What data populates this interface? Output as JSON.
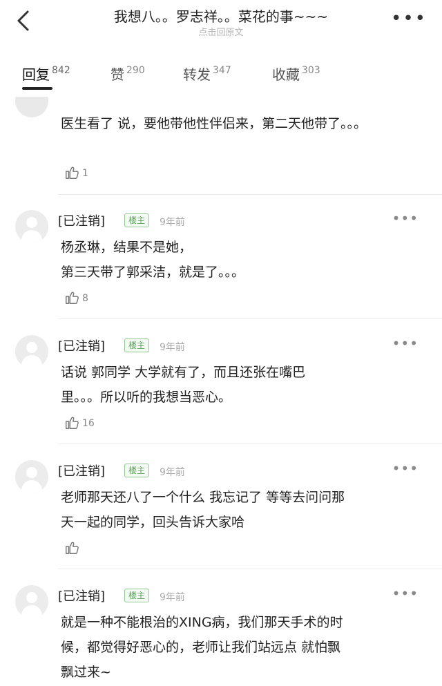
{
  "header": {
    "title": "我想八。。罗志祥。。菜花的事~~~",
    "subtitle": "点击回原文",
    "more_glyph": "•••"
  },
  "tabs": [
    {
      "label": "回复",
      "count": "842",
      "active": true
    },
    {
      "label": "赞",
      "count": "290",
      "active": false
    },
    {
      "label": "转发",
      "count": "347",
      "active": false
    },
    {
      "label": "收藏",
      "count": "303",
      "active": false
    }
  ],
  "top_comment": {
    "text": "医生看了 说，要他带他性伴侣来，第二天他带了。。。",
    "likes": "1"
  },
  "comments": [
    {
      "name": "[已注销]",
      "badge": "楼主",
      "time": "9年前",
      "text_lines": [
        "杨丞琳，结果不是她，",
        "第三天带了郭采洁，就是了。。。"
      ],
      "likes": "8"
    },
    {
      "name": "[已注销]",
      "badge": "楼主",
      "time": "9年前",
      "text_lines": [
        "话说 郭同学 大学就有了，而且还张在嘴巴",
        "里。。。所以听的我想当恶心。"
      ],
      "likes": "16"
    },
    {
      "name": "[已注销]",
      "badge": "楼主",
      "time": "9年前",
      "text_lines": [
        "老师那天还八了一个什么 我忘记了 等等去问问那",
        "天一起的同学，回头告诉大家哈"
      ],
      "likes": ""
    },
    {
      "name": "[已注销]",
      "badge": "楼主",
      "time": "9年前",
      "text_lines": [
        "就是一种不能根治的XING病，我们那天手术的时",
        "候，都觉得好恶心的，老师让我们站远点 就怕飘",
        "飘过来~"
      ],
      "likes": ""
    }
  ],
  "icons": {
    "back": "chevron-left-icon",
    "more": "more-dots-icon",
    "like": "thumbs-up-icon",
    "avatar": "default-avatar-icon"
  },
  "colors": {
    "badge_green": "#5aa05a",
    "muted_gray": "#aaaaaa",
    "text": "#222222"
  }
}
